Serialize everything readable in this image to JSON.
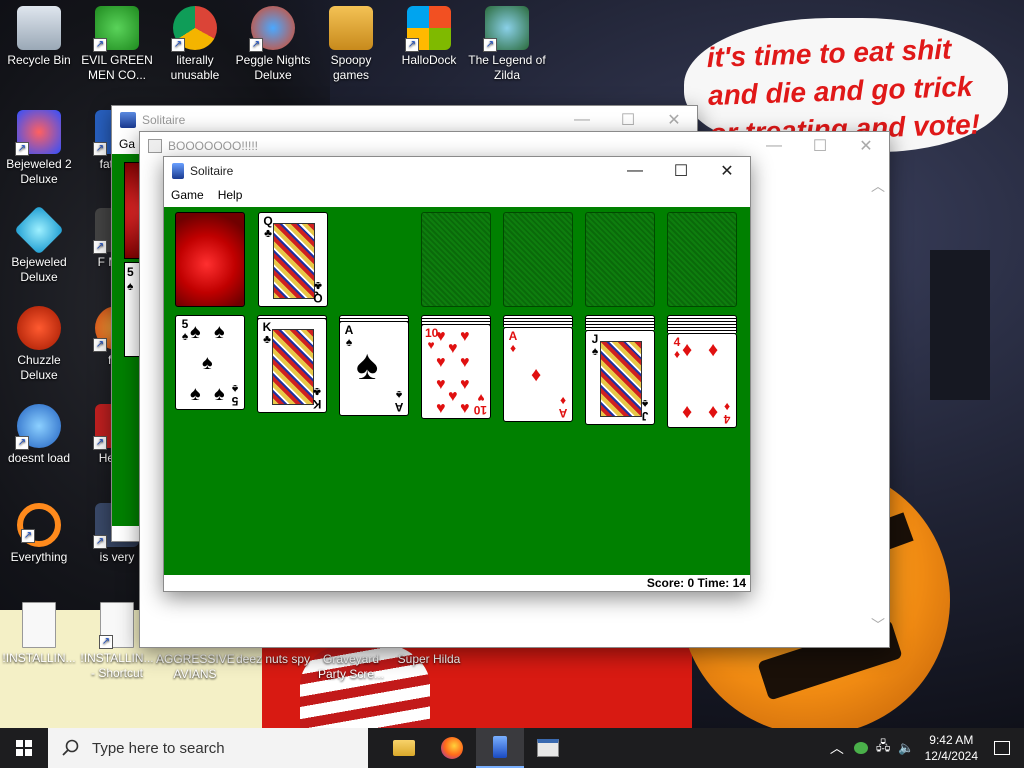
{
  "wallpaper": {
    "speech_line1": "it's time to eat shit",
    "speech_line2": "and die and go trick",
    "speech_line3": "or treating and vote!"
  },
  "desktop_icons": [
    {
      "label": "Recycle Bin",
      "icon": "recycle-bin-icon"
    },
    {
      "label": "EVIL GREEN MEN CO...",
      "icon": "green-men-icon"
    },
    {
      "label": "literally unusable",
      "icon": "chrome-icon"
    },
    {
      "label": "Peggle Nights Deluxe",
      "icon": "peggle-icon"
    },
    {
      "label": "Spoopy games",
      "icon": "folder-icon"
    },
    {
      "label": "HalloDock",
      "icon": "windows-logo-icon"
    },
    {
      "label": "The Legend of Zilda",
      "icon": "zilda-icon"
    },
    {
      "label": "Bejeweled 2 Deluxe",
      "icon": "bejeweled2-icon"
    },
    {
      "label": "fat like",
      "icon": "fat-icon"
    },
    {
      "label": "Bejeweled Deluxe",
      "icon": "bejeweled-icon"
    },
    {
      "label": "F MON",
      "icon": "f-mon-icon"
    },
    {
      "label": "Chuzzle Deluxe",
      "icon": "chuzzle-icon"
    },
    {
      "label": "furr",
      "icon": "furr-icon"
    },
    {
      "label": "doesnt load",
      "icon": "thunderbird-icon"
    },
    {
      "label": "He We",
      "icon": "he-we-icon"
    },
    {
      "label": "Everything",
      "icon": "everything-search-icon"
    },
    {
      "label": "is very",
      "icon": "is-very-icon"
    },
    {
      "label": "!INSTALLIN...",
      "icon": "document-icon"
    },
    {
      "label": "!INSTALLIN... - Shortcut",
      "icon": "document-shortcut-icon"
    },
    {
      "label": "AGGRESSIVE AVIANS",
      "icon": "avians-icon"
    },
    {
      "label": "deez nuts spy",
      "icon": "spy-icon"
    },
    {
      "label": "Graveyard Party Scre...",
      "icon": "graveyard-icon"
    },
    {
      "label": "Super Hilda",
      "icon": "hilda-icon"
    }
  ],
  "window_back": {
    "title": "Solitaire",
    "menu_partial": "Ga",
    "card_rank": "5",
    "card_suit": "♠"
  },
  "window_mid": {
    "title": "BOOOOOOO!!!!!"
  },
  "solitaire": {
    "title": "Solitaire",
    "menu": [
      "Game",
      "Help"
    ],
    "status": "Score: 0 Time: 14",
    "waste": {
      "rank": "Q",
      "suit": "♣"
    },
    "tableau": [
      {
        "rank": "5",
        "suit": "♠",
        "color": "blk",
        "face": false
      },
      {
        "rank": "K",
        "suit": "♣",
        "color": "blk",
        "face": true
      },
      {
        "rank": "A",
        "suit": "♠",
        "color": "blk",
        "face": false
      },
      {
        "rank": "10",
        "suit": "♥",
        "color": "red",
        "face": false
      },
      {
        "rank": "A",
        "suit": "♦",
        "color": "red",
        "face": false
      },
      {
        "rank": "J",
        "suit": "♠",
        "color": "blk",
        "face": true
      },
      {
        "rank": "4",
        "suit": "♦",
        "color": "red",
        "face": false
      }
    ]
  },
  "taskbar": {
    "search_placeholder": "Type here to search",
    "time": "9:42 AM",
    "date": "12/4/2024",
    "apps": [
      "file-explorer-icon",
      "firefox-icon",
      "solitaire-icon",
      "solitaire-alt-icon"
    ]
  }
}
